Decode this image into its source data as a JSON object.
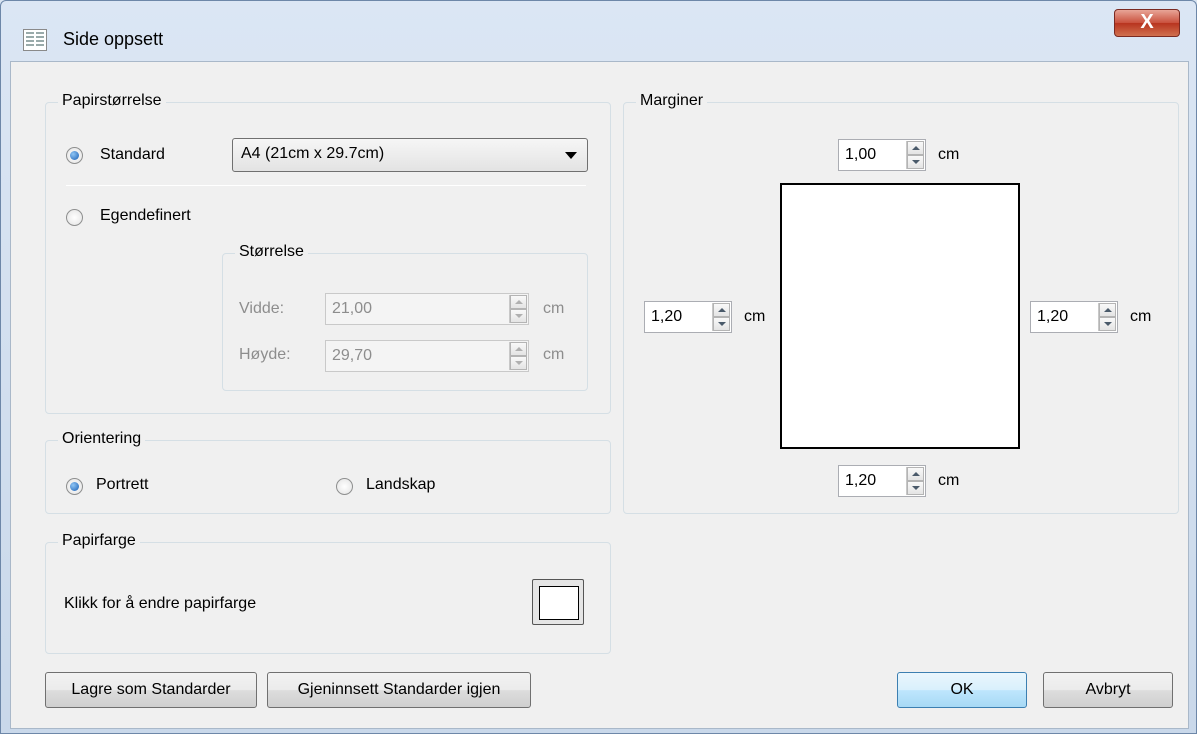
{
  "window": {
    "title": "Side oppsett",
    "close_label": "X"
  },
  "paper_size": {
    "group_title": "Papirstørrelse",
    "standard_label": "Standard",
    "standard_selected": true,
    "standard_value": "A4 (21cm x 29.7cm)",
    "custom_label": "Egendefinert",
    "custom_selected": false,
    "size_group_title": "Størrelse",
    "width_label": "Vidde:",
    "width_value": "21,00",
    "height_label": "Høyde:",
    "height_value": "29,70",
    "unit": "cm"
  },
  "orientation": {
    "group_title": "Orientering",
    "portrait_label": "Portrett",
    "portrait_selected": true,
    "landscape_label": "Landskap",
    "landscape_selected": false
  },
  "paper_color": {
    "group_title": "Papirfarge",
    "description": "Klikk for å endre papirfarge",
    "color": "#ffffff"
  },
  "margins": {
    "group_title": "Marginer",
    "top": "1,00",
    "left": "1,20",
    "right": "1,20",
    "bottom": "1,20",
    "unit": "cm"
  },
  "buttons": {
    "save_defaults": "Lagre som Standarder",
    "restore_defaults": "Gjeninnsett Standarder igjen",
    "ok": "OK",
    "cancel": "Avbryt"
  }
}
